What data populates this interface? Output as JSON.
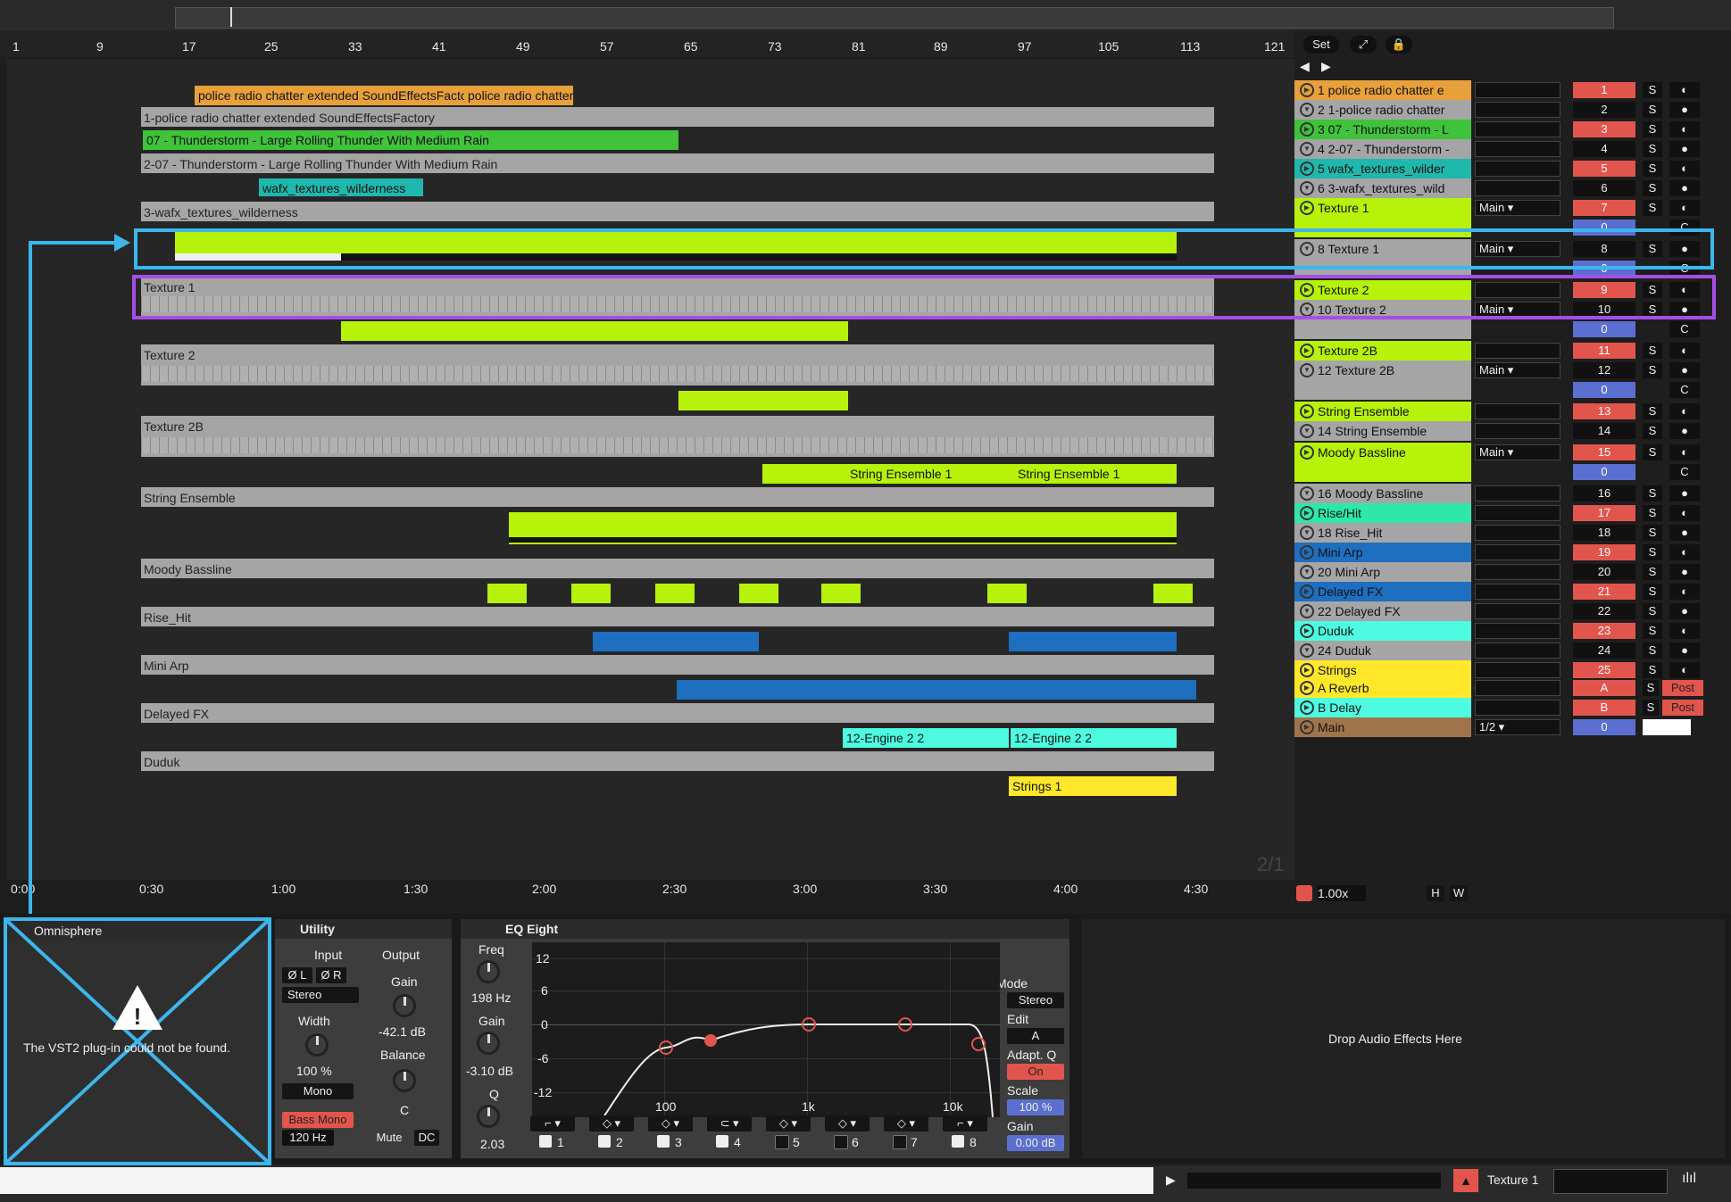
{
  "ruler": {
    "bars": [
      "1",
      "9",
      "17",
      "25",
      "33",
      "41",
      "49",
      "57",
      "65",
      "73",
      "81",
      "89",
      "97",
      "105",
      "113",
      "121"
    ]
  },
  "ruler_buttons": {
    "set": "Set",
    "expand_icon": "expand-icon",
    "lock_icon": "lock-icon",
    "back_icon": "arrow-left-icon",
    "forward_icon": "arrow-right-icon"
  },
  "clips": {
    "police1": "police radio chatter extended SoundEffectsFactory",
    "police2": "police radio chatter extended SoundEffectsFactory",
    "lane_police": "1-police radio chatter extended SoundEffectsFactory",
    "thunder": "07 - Thunderstorm - Large Rolling Thunder With Medium Rain",
    "lane_thunder": "2-07 - Thunderstorm - Large Rolling Thunder With Medium Rain",
    "wafx": "wafx_textures_wilderness",
    "lane_wafx": "3-wafx_textures_wilderness",
    "lane_texture1": "Texture 1",
    "lane_texture2": "Texture 2",
    "lane_texture2b": "Texture 2B",
    "string1": "String Ensemble 1",
    "string2": "String Ensemble 1",
    "lane_string": "String Ensemble",
    "lane_moody": "Moody Bassline",
    "lane_rise": "Rise_Hit",
    "lane_miniarp": "Mini Arp",
    "lane_delayed": "Delayed FX",
    "engine1": "12-Engine 2 2",
    "engine2": "12-Engine 2 2",
    "lane_duduk": "Duduk",
    "strings1": "Strings 1"
  },
  "time_ruler": [
    "0:00",
    "0:30",
    "1:00",
    "1:30",
    "2:00",
    "2:30",
    "3:00",
    "3:30",
    "4:00",
    "4:30"
  ],
  "page_indicator": "2/1",
  "tracks": [
    {
      "name": "1 police radio chatter e",
      "num": "1",
      "color": "#e8a03a",
      "armed": true
    },
    {
      "name": "2 1-police radio chatter",
      "num": "2",
      "color": "#a5a5a5",
      "armed": false
    },
    {
      "name": "3 07 - Thunderstorm - L",
      "num": "3",
      "color": "#3fc33a",
      "armed": true
    },
    {
      "name": "4 2-07 - Thunderstorm -",
      "num": "4",
      "color": "#a5a5a5",
      "armed": false
    },
    {
      "name": "5 wafx_textures_wilder",
      "num": "5",
      "color": "#1fb8ad",
      "armed": true
    },
    {
      "name": "6 3-wafx_textures_wild",
      "num": "6",
      "color": "#a5a5a5",
      "armed": false
    },
    {
      "name": "Texture 1",
      "num": "7",
      "color": "#b7f20a",
      "armed": true
    },
    {
      "name": "8 Texture 1",
      "num": "8",
      "color": "#a5a5a5",
      "armed": false
    },
    {
      "name": "Texture 2",
      "num": "9",
      "color": "#b7f20a",
      "armed": true
    },
    {
      "name": "10 Texture 2",
      "num": "10",
      "color": "#a5a5a5",
      "armed": false
    },
    {
      "name": "Texture 2B",
      "num": "11",
      "color": "#b7f20a",
      "armed": true
    },
    {
      "name": "12 Texture 2B",
      "num": "12",
      "color": "#a5a5a5",
      "armed": false
    },
    {
      "name": "String Ensemble",
      "num": "13",
      "color": "#b7f20a",
      "armed": true
    },
    {
      "name": "14 String Ensemble",
      "num": "14",
      "color": "#a5a5a5",
      "armed": false
    },
    {
      "name": "Moody Bassline",
      "num": "15",
      "color": "#b7f20a",
      "armed": true
    },
    {
      "name": "16 Moody Bassline",
      "num": "16",
      "color": "#a5a5a5",
      "armed": false
    },
    {
      "name": "Rise/Hit",
      "num": "17",
      "color": "#2ee8a8",
      "armed": true
    },
    {
      "name": "18 Rise_Hit",
      "num": "18",
      "color": "#a5a5a5",
      "armed": false
    },
    {
      "name": "Mini Arp",
      "num": "19",
      "color": "#1e6fc0",
      "armed": true
    },
    {
      "name": "20 Mini Arp",
      "num": "20",
      "color": "#a5a5a5",
      "armed": false
    },
    {
      "name": "Delayed FX",
      "num": "21",
      "color": "#1e6fc0",
      "armed": true
    },
    {
      "name": "22 Delayed FX",
      "num": "22",
      "color": "#a5a5a5",
      "armed": false
    },
    {
      "name": "Duduk",
      "num": "23",
      "color": "#4dfbe0",
      "armed": true
    },
    {
      "name": "24 Duduk",
      "num": "24",
      "color": "#a5a5a5",
      "armed": false
    },
    {
      "name": "Strings",
      "num": "25",
      "color": "#ffe82a",
      "armed": true
    }
  ],
  "mixer_labels": {
    "main": "Main",
    "solo": "S",
    "zero": "0",
    "c": "C",
    "post": "Post",
    "half": "1/2"
  },
  "returns": [
    {
      "name": "A Reverb",
      "letter": "A",
      "color": "#ffe82a"
    },
    {
      "name": "B Delay",
      "letter": "B",
      "color": "#4dfbe0"
    },
    {
      "name": "Main",
      "letter": "0",
      "color": "#a0744a"
    }
  ],
  "zoom": {
    "value": "1.00x",
    "h": "H",
    "w": "W"
  },
  "omnisphere": {
    "title": "Omnisphere",
    "message": "The VST2 plug-in could not be found."
  },
  "utility": {
    "title": "Utility",
    "input": "Input",
    "output": "Output",
    "phase_l": "Ø L",
    "phase_r": "Ø R",
    "stereo": "Stereo",
    "width": "Width",
    "width_val": "100 %",
    "mono": "Mono",
    "bass_mono": "Bass Mono",
    "bass_freq": "120 Hz",
    "gain": "Gain",
    "gain_val": "-42.1 dB",
    "balance": "Balance",
    "balance_val": "C",
    "mute": "Mute",
    "dc": "DC"
  },
  "eq": {
    "title": "EQ Eight",
    "freq": "Freq",
    "freq_val": "198 Hz",
    "gain": "Gain",
    "gain_val": "-3.10 dB",
    "q": "Q",
    "q_val": "2.03",
    "y_ticks": [
      "12",
      "6",
      "0",
      "-6",
      "-12"
    ],
    "x_ticks": [
      "100",
      "1k",
      "10k"
    ],
    "bands": [
      "1",
      "2",
      "3",
      "4",
      "5",
      "6",
      "7",
      "8"
    ],
    "mode": "Mode",
    "mode_val": "Stereo",
    "edit": "Edit",
    "edit_val": "A",
    "adapt_q": "Adapt. Q",
    "adapt_q_val": "On",
    "scale": "Scale",
    "scale_val": "100 %",
    "out_gain": "Gain",
    "out_gain_val": "0.00 dB"
  },
  "drop_zone": "Drop Audio Effects Here",
  "status": {
    "track": "Texture 1"
  }
}
